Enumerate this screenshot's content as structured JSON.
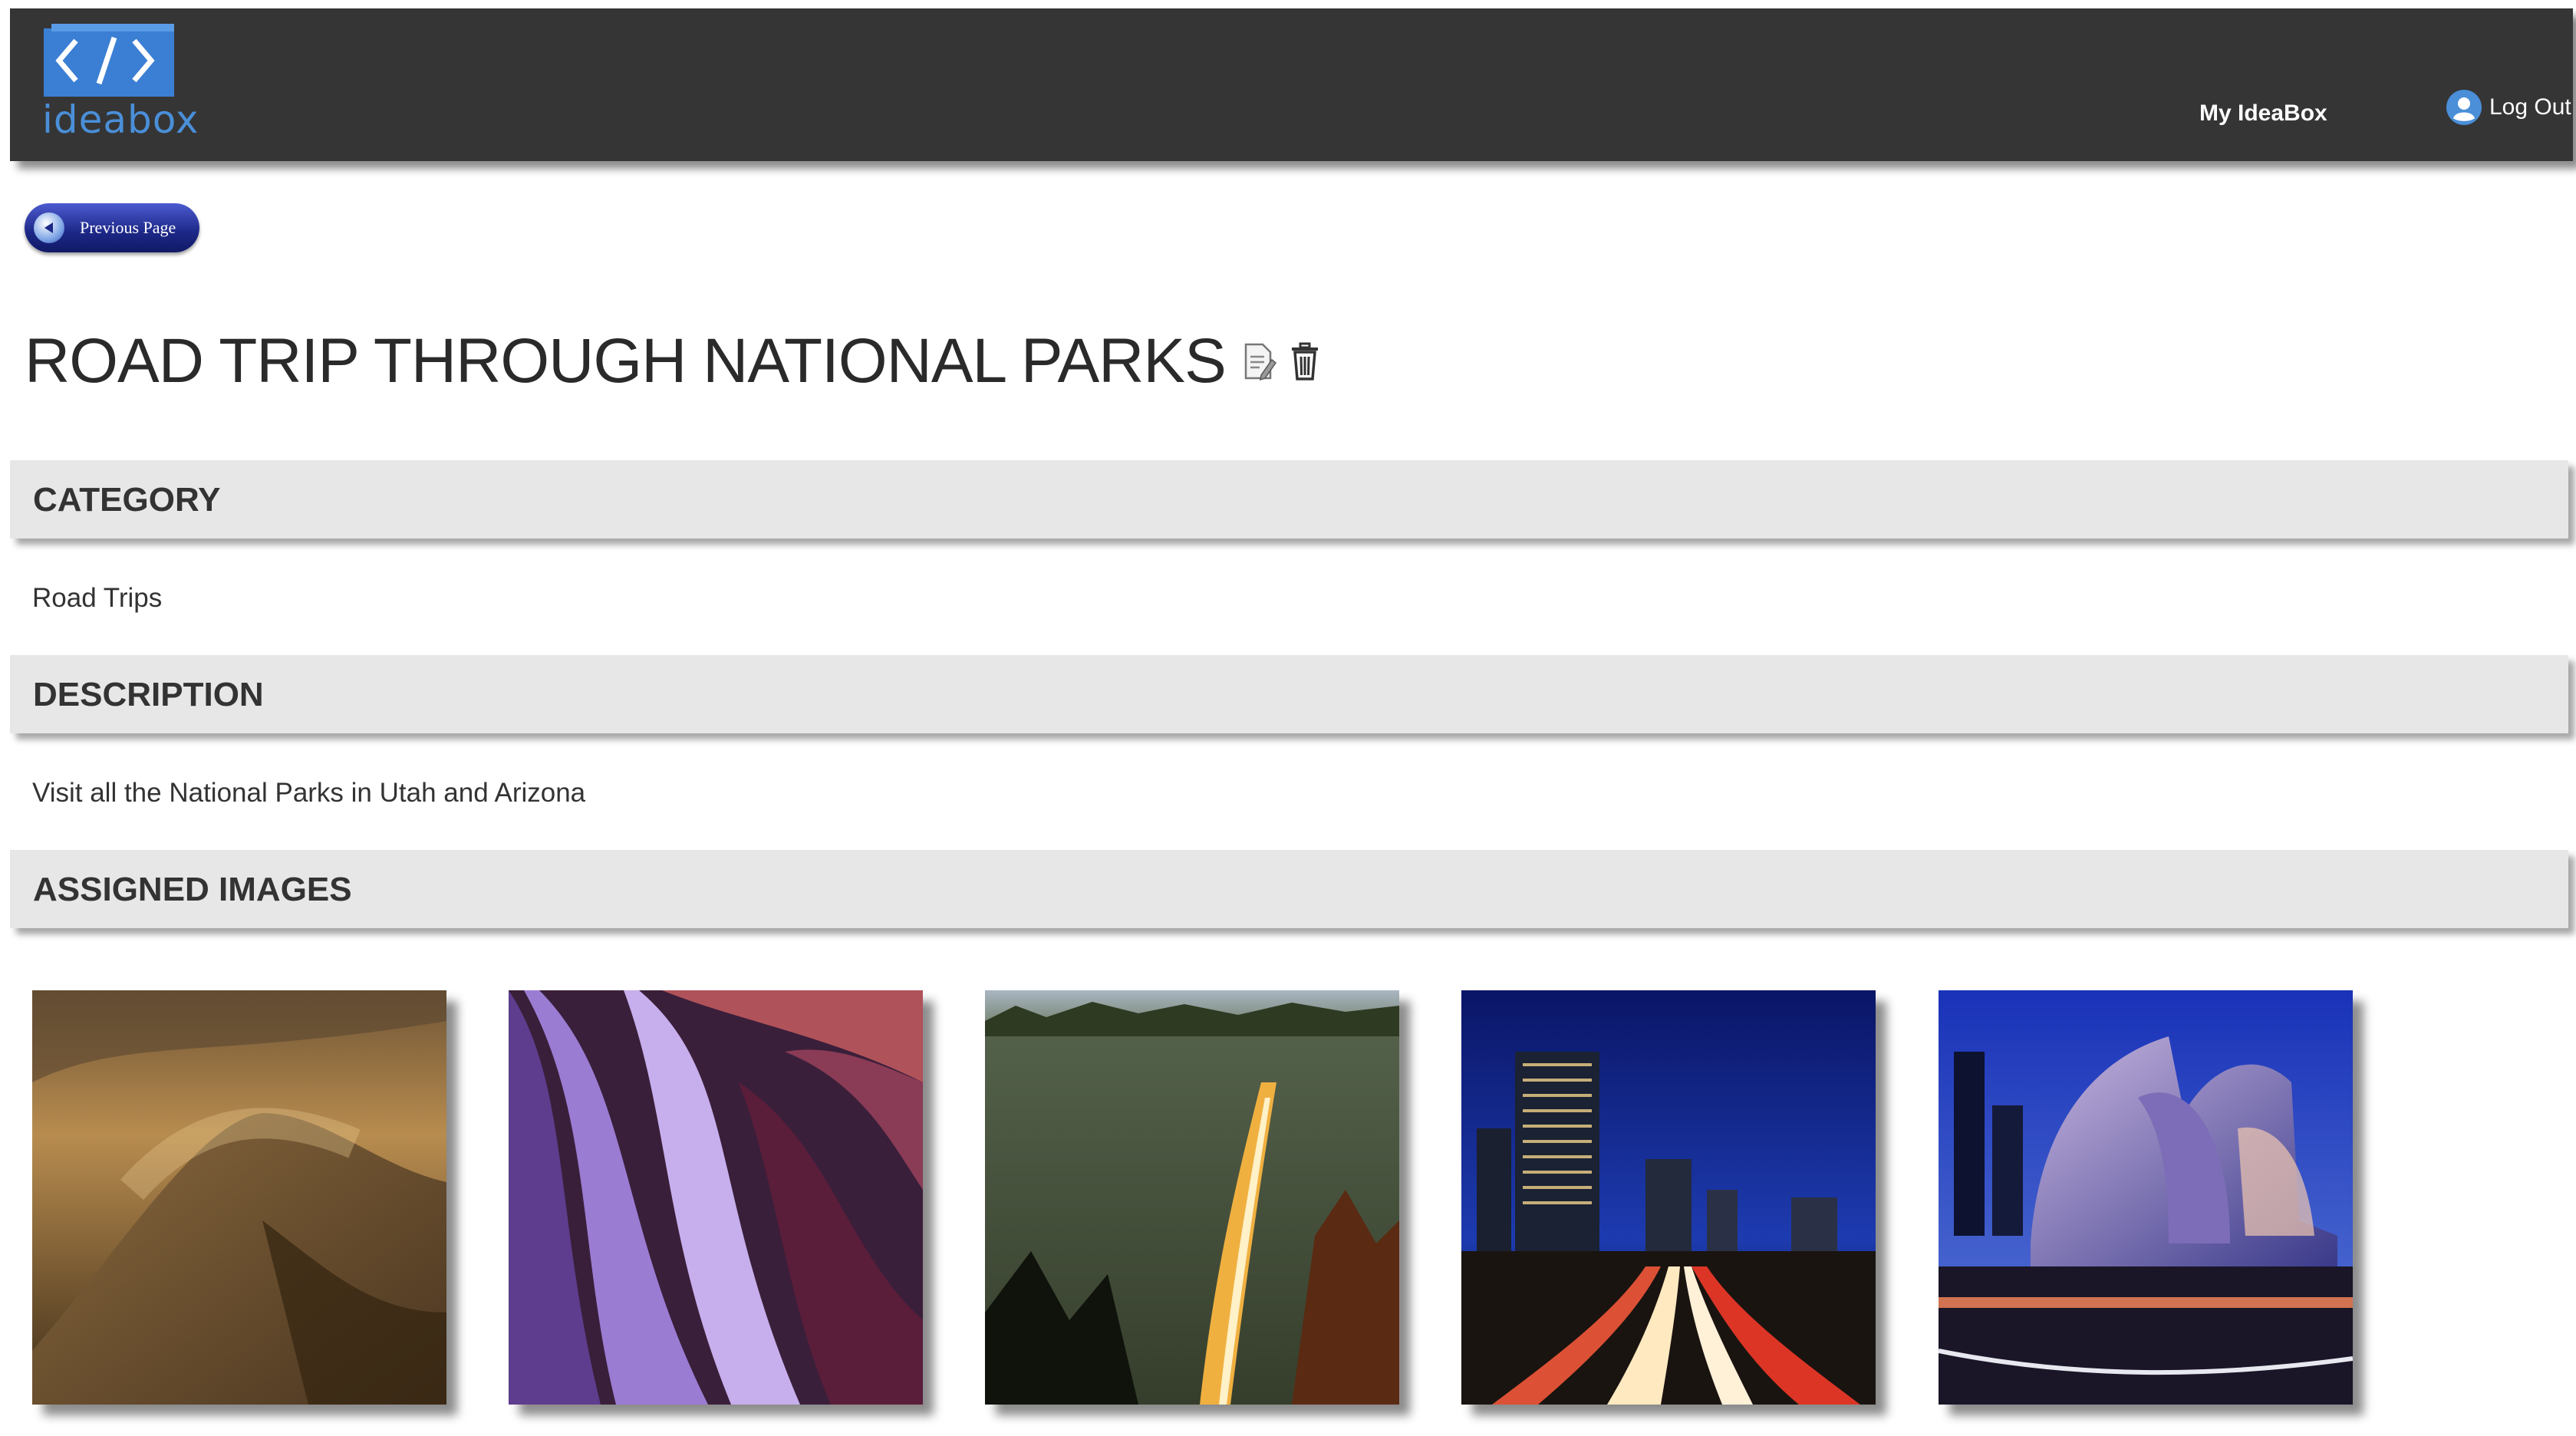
{
  "header": {
    "logo_text": "ideabox",
    "nav": {
      "my_ideabox": "My IdeaBox",
      "log_out": "Log Out"
    }
  },
  "prev_button": {
    "label": "Previous Page"
  },
  "idea": {
    "title": "ROAD TRIP THROUGH NATIONAL PARKS",
    "sections": {
      "category": {
        "heading": "CATEGORY",
        "value": "Road Trips"
      },
      "description": {
        "heading": "DESCRIPTION",
        "value": "Visit all the National Parks in Utah and Arizona"
      },
      "images": {
        "heading": "ASSIGNED IMAGES"
      }
    }
  },
  "images": [
    {
      "subject": "sand dune"
    },
    {
      "subject": "slot canyon"
    },
    {
      "subject": "waterfall"
    },
    {
      "subject": "city highway at night"
    },
    {
      "subject": "concert hall at dusk"
    }
  ],
  "colors": {
    "header_bg": "#353535",
    "brand_blue": "#4a8fd8",
    "section_bg": "#e7e7e7",
    "button_blue": "#1c2786"
  },
  "icons": [
    "code-box-logo-icon",
    "user-avatar-icon",
    "back-arrow-icon",
    "edit-document-icon",
    "trash-icon"
  ]
}
